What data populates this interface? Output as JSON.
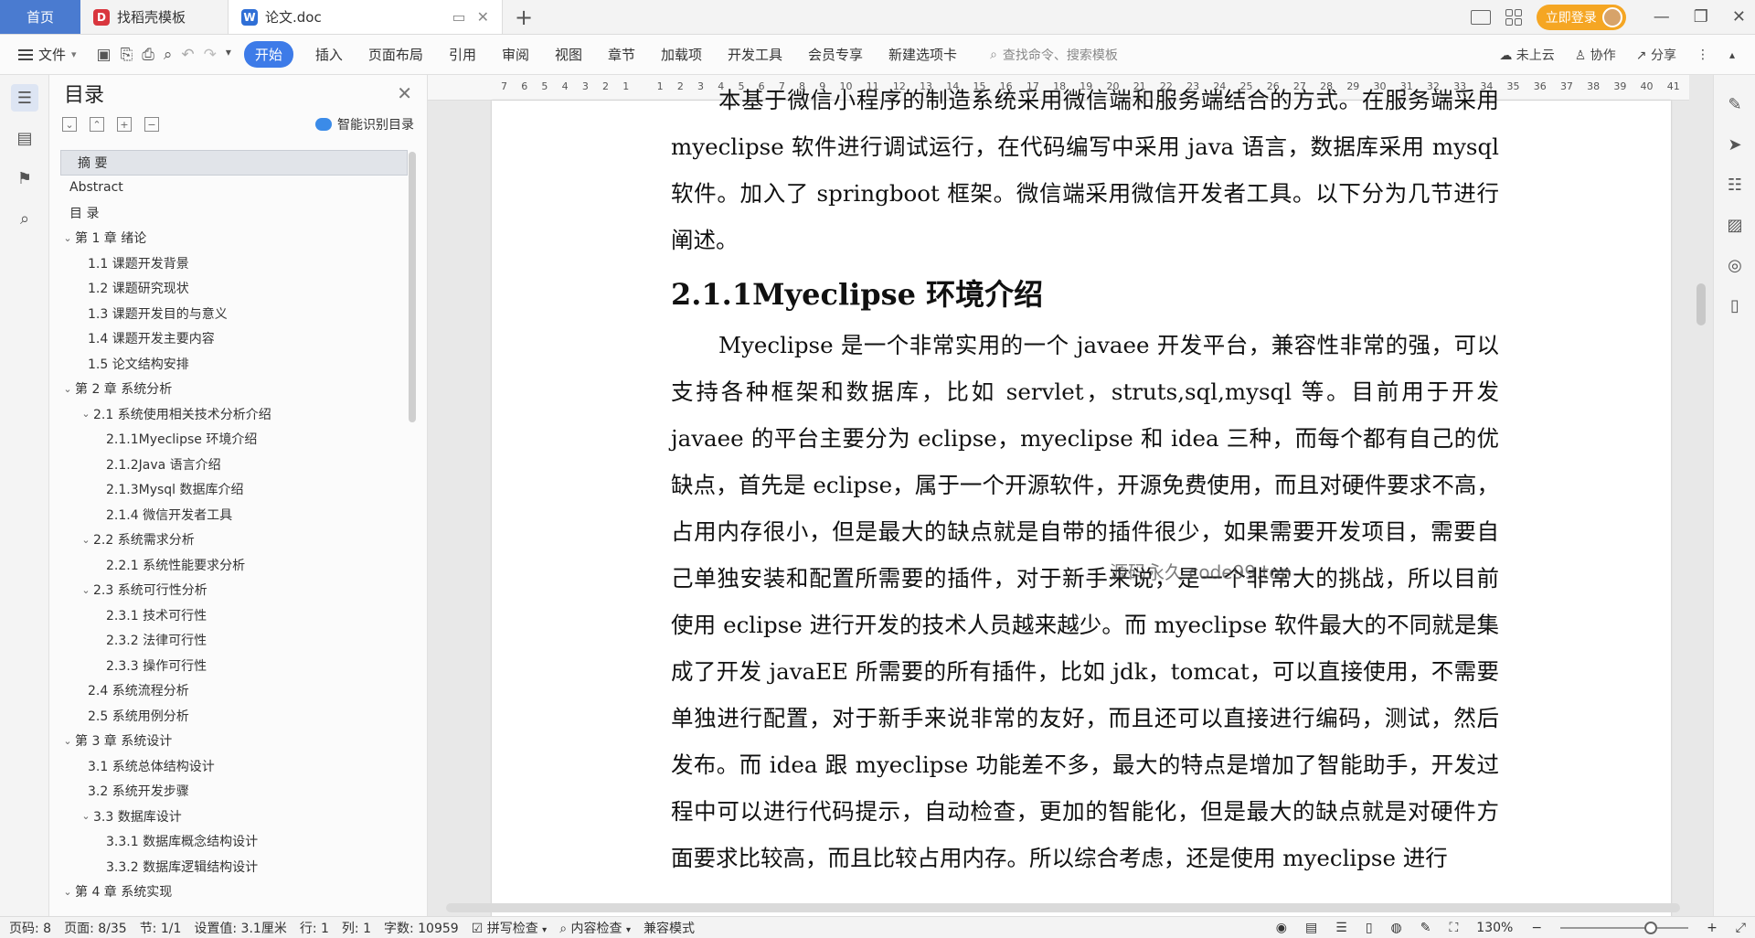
{
  "titlebar": {
    "home_tab": "首页",
    "tab1_label": "找稻壳模板",
    "tab2_label": "论文.doc",
    "new_tab": "+",
    "login_label": "立即登录"
  },
  "toolbar": {
    "file_label": "文件",
    "ribbon_tabs": [
      "开始",
      "插入",
      "页面布局",
      "引用",
      "审阅",
      "视图",
      "章节",
      "加载项",
      "开发工具",
      "会员专享",
      "新建选项卡"
    ],
    "search_placeholder": "查找命令、搜索模板",
    "cloud_label": "未上云",
    "collab_label": "协作",
    "share_label": "分享"
  },
  "toc": {
    "title": "目录",
    "ai_label": "智能识别目录",
    "items": [
      {
        "label": "摘  要",
        "level": 0,
        "selected": true
      },
      {
        "label": "Abstract",
        "level": 0
      },
      {
        "label": "目  录",
        "level": 0
      },
      {
        "label": "第 1 章   绪论",
        "level": 0,
        "caret": true
      },
      {
        "label": "1.1 课题开发背景",
        "level": 1
      },
      {
        "label": "1.2 课题研究现状",
        "level": 1
      },
      {
        "label": "1.3 课题开发目的与意义",
        "level": 1
      },
      {
        "label": "1.4 课题开发主要内容",
        "level": 1
      },
      {
        "label": "1.5 论文结构安排",
        "level": 1
      },
      {
        "label": "第 2 章  系统分析",
        "level": 0,
        "caret": true
      },
      {
        "label": "2.1 系统使用相关技术分析介绍",
        "level": 1,
        "caret": true
      },
      {
        "label": "2.1.1Myeclipse 环境介绍",
        "level": 2
      },
      {
        "label": "2.1.2Java 语言介绍",
        "level": 2
      },
      {
        "label": " 2.1.3Mysql 数据库介绍",
        "level": 2
      },
      {
        "label": "2.1.4 微信开发者工具",
        "level": 2
      },
      {
        "label": "2.2 系统需求分析",
        "level": 1,
        "caret": true
      },
      {
        "label": "2.2.1 系统性能要求分析",
        "level": 2
      },
      {
        "label": "2.3 系统可行性分析",
        "level": 1,
        "caret": true
      },
      {
        "label": "2.3.1 技术可行性",
        "level": 2
      },
      {
        "label": "2.3.2 法律可行性",
        "level": 2
      },
      {
        "label": "2.3.3 操作可行性",
        "level": 2
      },
      {
        "label": "2.4 系统流程分析",
        "level": 1
      },
      {
        "label": "2.5 系统用例分析",
        "level": 1
      },
      {
        "label": "第 3 章  系统设计",
        "level": 0,
        "caret": true
      },
      {
        "label": "3.1 系统总体结构设计",
        "level": 1
      },
      {
        "label": "3.2 系统开发步骤",
        "level": 1
      },
      {
        "label": "3.3 数据库设计",
        "level": 1,
        "caret": true
      },
      {
        "label": "3.3.1 数据库概念结构设计",
        "level": 2
      },
      {
        "label": "3.3.2 数据库逻辑结构设计",
        "level": 2
      },
      {
        "label": "第 4 章  系统实现",
        "level": 0,
        "caret": true
      }
    ]
  },
  "ruler": {
    "numbers": [
      "7",
      "6",
      "5",
      "4",
      "3",
      "2",
      "1",
      "",
      "1",
      "2",
      "3",
      "4",
      "5",
      "6",
      "7",
      "8",
      "9",
      "10",
      "11",
      "12",
      "13",
      "14",
      "15",
      "16",
      "17",
      "18",
      "19",
      "20",
      "21",
      "22",
      "23",
      "24",
      "25",
      "26",
      "27",
      "28",
      "29",
      "30",
      "31",
      "32",
      "33",
      "34",
      "35",
      "36",
      "37",
      "38",
      "39",
      "40",
      "41"
    ]
  },
  "document": {
    "para_top": "本基于微信小程序的制造系统采用微信端和服务端结合的方式。在服务端采用 myeclipse 软件进行调试运行，在代码编写中采用 java 语言，数据库采用 mysql 软件。加入了 springboot 框架。微信端采用微信开发者工具。以下分为几节进行阐述。",
    "heading": "2.1.1Myeclipse 环境介绍",
    "para_main": "Myeclipse 是一个非常实用的一个 javaee 开发平台，兼容性非常的强，可以支持各种框架和数据库，比如 servlet，struts,sql,mysql 等。目前用于开发 javaee 的平台主要分为 eclipse，myeclipse 和 idea 三种，而每个都有自己的优缺点，首先是 eclipse，属于一个开源软件，开源免费使用，而且对硬件要求不高，占用内存很小，但是最大的缺点就是自带的插件很少，如果需要开发项目，需要自己单独安装和配置所需要的插件，对于新手来说，是一个非常大的挑战，所以目前使用 eclipse 进行开发的技术人员越来越少。而 myeclipse 软件最大的不同就是集成了开发 javaEE 所需要的所有插件，比如 jdk，tomcat，可以直接使用，不需要单独进行配置，对于新手来说非常的友好，而且还可以直接进行编码，测试，然后发布。而 idea 跟 myeclipse 功能差不多，最大的特点是增加了智能助手，开发过程中可以进行代码提示，自动检查，更加的智能化，但是最大的缺点就是对硬件方面要求比较高，而且比较占用内存。所以综合考虑，还是使用 myeclipse 进行",
    "watermark": "源码永久 code99.top"
  },
  "status": {
    "page_code": "页码: 8",
    "page": "页面: 8/35",
    "section": "节: 1/1",
    "setting": "设置值: 3.1厘米",
    "row": "行: 1",
    "col": "列: 1",
    "words": "字数: 10959",
    "spell": "拼写检查",
    "content_check": "内容检查",
    "compat": "兼容模式",
    "zoom": "130%"
  }
}
